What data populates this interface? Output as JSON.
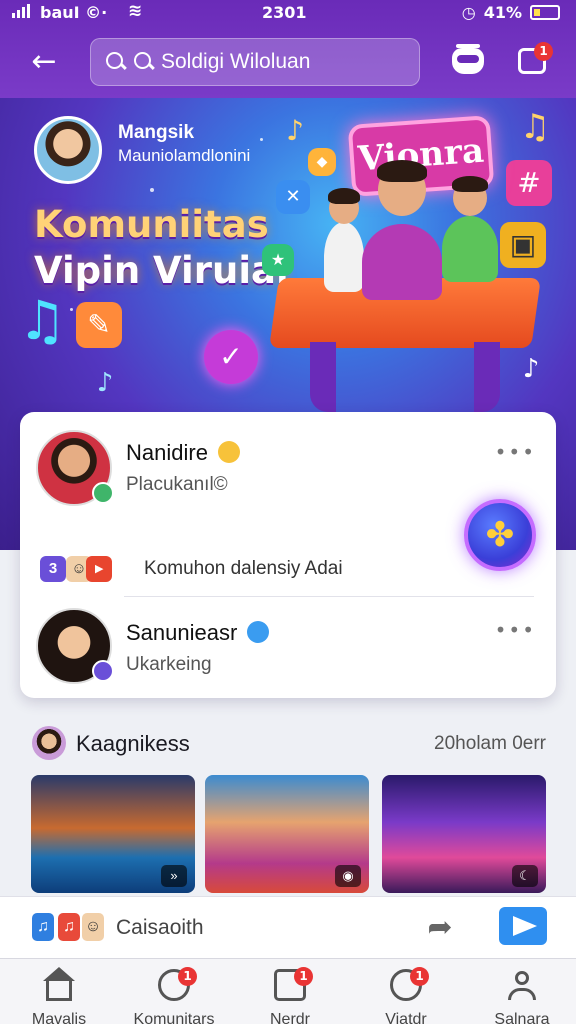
{
  "status_bar": {
    "carrier": "bauI ©·",
    "time": "2301",
    "battery": "41%"
  },
  "header": {
    "search_placeholder": "Soldigi Wiloluan",
    "notification_count": "1"
  },
  "hero": {
    "user_name": "Mangsik",
    "user_subtitle": "Mauniolamdlonini",
    "title_line1": "Komuniitas",
    "title_line2": "Vipin Viruial",
    "sign_text": "Vionra"
  },
  "posts": [
    {
      "name": "Nanidire",
      "subtitle": "Placukanıl©"
    },
    {
      "name": "Sanunieasr",
      "subtitle": "Ukarkeing"
    }
  ],
  "community_line": {
    "badge_number": "3",
    "text": "Komuhon dalensiy Adai"
  },
  "section": {
    "title": "Kaagnikess",
    "meta": "20holam 0err"
  },
  "composer": {
    "placeholder": "Caisaoith"
  },
  "bottom_nav": [
    {
      "label": "Mavalis",
      "badge": ""
    },
    {
      "label": "Komunitars",
      "badge": "1"
    },
    {
      "label": "Nerdr",
      "badge": "1"
    },
    {
      "label": "Viatdr",
      "badge": "1"
    },
    {
      "label": "Salnara",
      "badge": ""
    }
  ],
  "colors": {
    "header_purple": "#6a2bb8",
    "accent_blue": "#2f8ff0",
    "badge_red": "#e93434"
  }
}
